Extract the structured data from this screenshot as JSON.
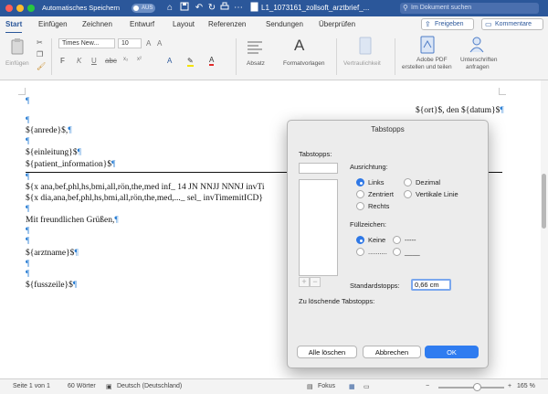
{
  "titlebar": {
    "autosave_label": "Automatisches Speichern",
    "autosave_state": "AUS",
    "doc_title": "L1_1073161_zollsoft_arztbrief_...",
    "search_placeholder": "Im Dokument suchen",
    "accent": "#2b579a"
  },
  "ribbon_tabs": [
    "Start",
    "Einfügen",
    "Zeichnen",
    "Entwurf",
    "Layout",
    "Referenzen",
    "Sendungen",
    "Überprüfen"
  ],
  "share_label": "Freigeben",
  "comments_label": "Kommentare",
  "ribbon": {
    "paste_label": "Einfügen",
    "font_name": "Times New...",
    "font_size": "10",
    "paragraph_label": "Absatz",
    "styles_label": "Formatvorlagen",
    "confidentiality_label": "Vertraulichkeit",
    "pdf_label_1": "Adobe PDF",
    "pdf_label_2": "erstellen und teilen",
    "sign_label_1": "Unterschriften",
    "sign_label_2": "anfragen"
  },
  "document": {
    "mark": "¶",
    "right_line": "${ort}$, den ${datum}$",
    "lines": {
      "anrede": "${anrede}$,",
      "einleitung": "${einleitung}$",
      "patient": "${patient_information}$",
      "line_a": "${x ana,bef,phl,hs,bmi,all,rön,the,med inf_ 14 JN NNJJ NNNJ invTi",
      "line_b": "${x dia,ana,bef,phl,hs,bmi,all,rön,the,med,..._ sel_ invTimemitICD}",
      "gruss": "Mit freundlichen Grüßen,",
      "arztname": "${arztname}$",
      "fusszeile": "${fusszeile}$"
    }
  },
  "dialog": {
    "title": "Tabstopps",
    "tabstops_label": "Tabstopps:",
    "alignment_label": "Ausrichtung:",
    "align_links": "Links",
    "align_dezimal": "Dezimal",
    "align_zentriert": "Zentriert",
    "align_vertikal": "Vertikale Linie",
    "align_rechts": "Rechts",
    "fill_label": "Füllzeichen:",
    "fill_keine": "Keine",
    "fill_dash": "-----",
    "fill_dot": "..........",
    "fill_line": "____",
    "default_label": "Standardstopps:",
    "default_value": "0,66 cm",
    "delete_label": "Zu löschende Tabstopps:",
    "btn_delete_all": "Alle löschen",
    "btn_cancel": "Abbrechen",
    "btn_ok": "OK"
  },
  "status": {
    "page": "Seite 1 von 1",
    "words": "60 Wörter",
    "language": "Deutsch (Deutschland)",
    "focus": "Fokus",
    "zoom": "165 %"
  }
}
